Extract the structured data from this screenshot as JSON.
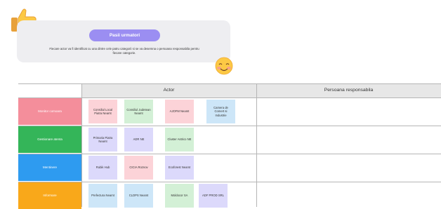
{
  "intro": {
    "button_label": "Pasii urmatori",
    "description": "Fiecare actor va fi identificat cu una dintre cele patru categorii si se va desemna o persoana responsabila pentru fiecare categorie."
  },
  "table": {
    "headers": {
      "actor": "Actor",
      "responsible": "Persoana responsabila"
    },
    "rows": [
      {
        "category": "Monitor comoara",
        "color": "#f48e9b",
        "notes": [
          {
            "label": "Consiliul Local Piatra Neamt",
            "color": "#fcd3d8"
          },
          {
            "label": "Consiliul Judetean Neamt",
            "color": "#d3f0d6"
          },
          {
            "label": "AJOFM Neamt",
            "color": "#fcd3d8"
          },
          {
            "label": "Camera de Comert si Industrie",
            "color": "#cde6f8"
          }
        ]
      },
      {
        "category": "Gestionare atenta",
        "color": "#34b559",
        "notes": [
          {
            "label": "Primaria Piatra Neamt",
            "color": "#dcd9fb"
          },
          {
            "label": "ADR NE",
            "color": "#dcd9fb"
          },
          {
            "label": "Cluster Astrico NE",
            "color": "#d3f0d6"
          }
        ]
      },
      {
        "category": "Mentinere",
        "color": "#2e9bf0",
        "notes": [
          {
            "label": "Rubik Hub",
            "color": "#dcd9fb"
          },
          {
            "label": "CICIA Roznov",
            "color": "#fcd3d8"
          },
          {
            "label": "Ecoforest Neamt",
            "color": "#dcd9fb"
          }
        ]
      },
      {
        "category": "Informare",
        "color": "#f9a81a",
        "notes": [
          {
            "label": "Prefectura Neamt",
            "color": "#cde6f8"
          },
          {
            "label": "CLDPS Neamt",
            "color": "#cde6f8"
          },
          {
            "label": "Moldocor SA",
            "color": "#d3f0d6"
          },
          {
            "label": "ADF PROD SRL",
            "color": "#dcd9fb"
          }
        ]
      }
    ]
  }
}
